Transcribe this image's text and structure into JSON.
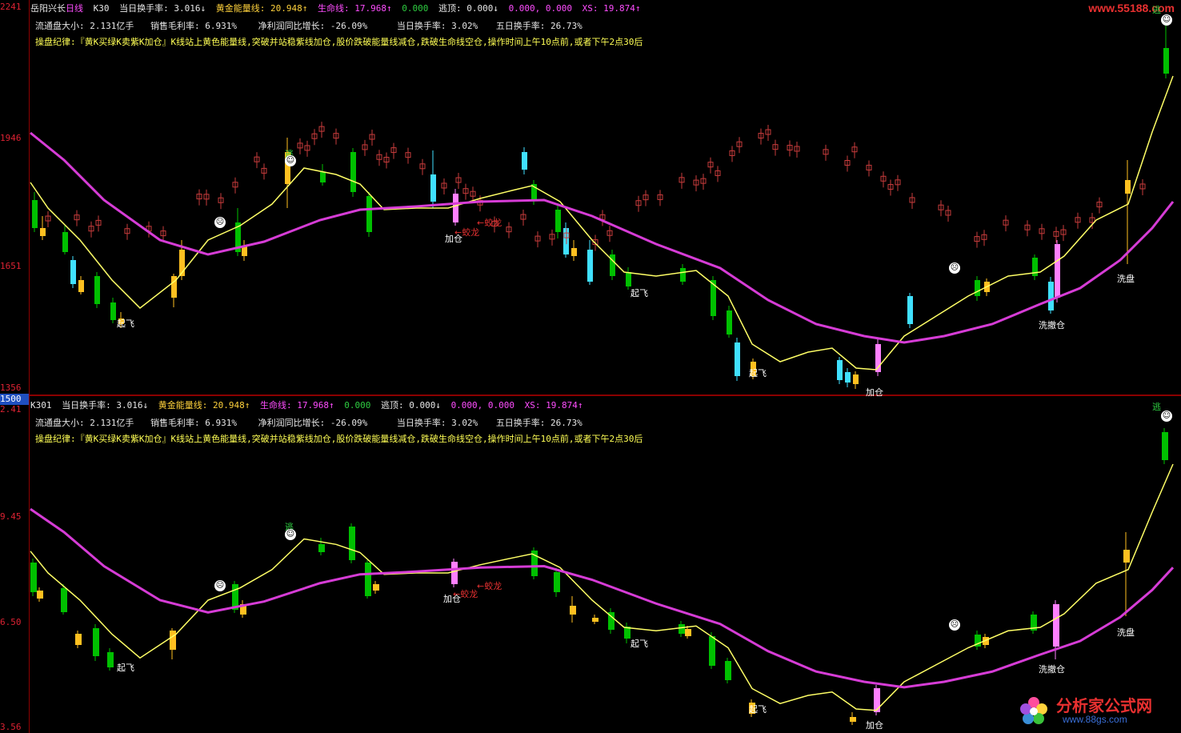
{
  "axis": {
    "top_ticks": [
      "2241",
      "1946",
      "1651",
      "1356"
    ],
    "badge": "1500",
    "bottom_ticks": [
      "2.41",
      "9.45",
      "6.50",
      "3.56"
    ]
  },
  "top": {
    "stock_name": "岳阳兴长",
    "period": "日线",
    "indicator": "K30",
    "line1": [
      {
        "text": "当日换手率: 3.016↓",
        "color": "#e6e6e6"
      },
      {
        "text": "黄金能量线: 20.948↑",
        "color": "#ffd23c"
      },
      {
        "text": "生命线: 17.968↑",
        "color": "#ff4dff"
      },
      {
        "text": "0.000",
        "color": "#2ecc40"
      },
      {
        "text": "逃顶: 0.000↓",
        "color": "#e6e6e6"
      },
      {
        "text": "0.000, 0.000",
        "color": "#ff4dff"
      },
      {
        "text": "XS: 19.874↑",
        "color": "#ff4dff"
      }
    ],
    "line2": [
      {
        "text": "流通盘大小: 2.131亿手"
      },
      {
        "text": "销售毛利率: 6.931%"
      },
      {
        "text": "净利润同比增长: -26.09%"
      },
      {
        "text": "当日换手率: 3.02%"
      },
      {
        "text": "五日换手率: 26.73%"
      }
    ],
    "rule": "操盘纪律:『黄K买绿K卖紫K加仓』K线站上黄色能量线,突破并站稳紫线加仓,股价跌破能量线减仓,跌破生命线空仓,操作时间上午10点前,或者下午2点30后",
    "annotations": [
      {
        "text": "起飞",
        "cls": ""
      },
      {
        "text": "加仓",
        "cls": ""
      },
      {
        "text": "←蛟龙",
        "cls": "red"
      },
      {
        "text": "←蛟龙",
        "cls": "red"
      },
      {
        "text": "起飞",
        "cls": ""
      },
      {
        "text": "起飞",
        "cls": ""
      },
      {
        "text": "加仓",
        "cls": ""
      },
      {
        "text": "洗撤仓",
        "cls": ""
      },
      {
        "text": "洗盘",
        "cls": ""
      },
      {
        "text": "逃",
        "cls": "green"
      },
      {
        "text": "逃",
        "cls": "green"
      }
    ]
  },
  "bottom": {
    "indicator": "K301",
    "line1": [
      {
        "text": "当日换手率: 3.016↓",
        "color": "#e6e6e6"
      },
      {
        "text": "黄金能量线: 20.948↑",
        "color": "#ffd23c"
      },
      {
        "text": "生命线: 17.968↑",
        "color": "#ff4dff"
      },
      {
        "text": "0.000",
        "color": "#2ecc40"
      },
      {
        "text": "逃顶: 0.000↓",
        "color": "#e6e6e6"
      },
      {
        "text": "0.000, 0.000",
        "color": "#ff4dff"
      },
      {
        "text": "XS: 19.874↑",
        "color": "#ff4dff"
      }
    ],
    "line2": [
      {
        "text": "流通盘大小: 2.131亿手"
      },
      {
        "text": "销售毛利率: 6.931%"
      },
      {
        "text": "净利润同比增长: -26.09%"
      },
      {
        "text": "当日换手率: 3.02%"
      },
      {
        "text": "五日换手率: 26.73%"
      }
    ],
    "rule": "操盘纪律:『黄K买绿K卖紫K加仓』K线站上黄色能量线,突破并站稳紫线加仓,股价跌破能量线减仓,跌破生命线空仓,操作时间上午10点前,或者下午2点30后",
    "annotations": [
      {
        "text": "起飞",
        "cls": ""
      },
      {
        "text": "加仓",
        "cls": ""
      },
      {
        "text": "←蛟龙",
        "cls": "red"
      },
      {
        "text": "←蛟龙",
        "cls": "red"
      },
      {
        "text": "起飞",
        "cls": ""
      },
      {
        "text": "起飞",
        "cls": ""
      },
      {
        "text": "加仓",
        "cls": ""
      },
      {
        "text": "洗撤仓",
        "cls": ""
      },
      {
        "text": "洗盘",
        "cls": ""
      },
      {
        "text": "逃",
        "cls": "green"
      },
      {
        "text": "逃",
        "cls": "green"
      }
    ]
  },
  "watermark_top": "www.55188.com",
  "logo": {
    "title": "分析家公式网",
    "url": "www.88gs.com"
  },
  "colors": {
    "yellow_line": "#ffff66",
    "life_line": "#d63cd6",
    "bull": "#00c000",
    "bear": "#40e0ff",
    "gold": "#ffc020",
    "purple": "#ff80ff"
  }
}
